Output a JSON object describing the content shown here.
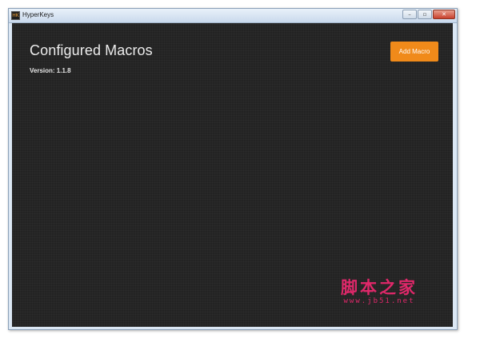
{
  "window": {
    "title": "HyperKeys",
    "icon": "HK",
    "controls": {
      "minimize": "–",
      "maximize": "▫",
      "close": "✕"
    }
  },
  "main": {
    "title": "Configured Macros",
    "version": "Version: 1.1.8",
    "add_button_label": "Add Macro"
  },
  "watermark": {
    "line1": "脚本之家",
    "line2": "www.jb51.net"
  },
  "colors": {
    "background": "#232323",
    "accent": "#f08a1a",
    "watermark": "#e0286a"
  }
}
